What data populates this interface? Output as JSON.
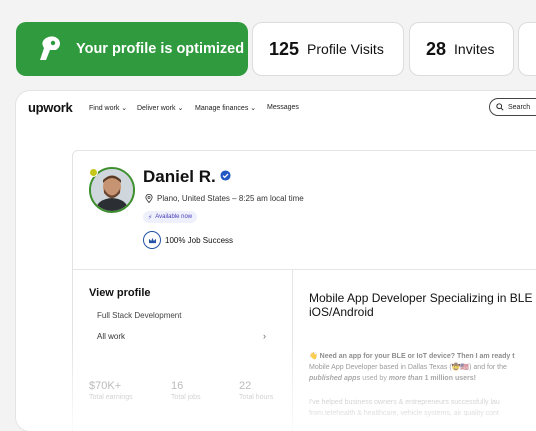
{
  "stats": {
    "optimized_text": "Your profile is optimized",
    "visits_count": "125",
    "visits_label": "Profile Visits",
    "invites_count": "28",
    "invites_label": "Invites",
    "accent_green": "#2f9a3e"
  },
  "nav": {
    "brand": "upwork",
    "items": [
      "Find work",
      "Deliver work",
      "Manage finances",
      "Messages"
    ],
    "search_placeholder": "Search"
  },
  "profile": {
    "name": "Daniel R.",
    "location": "Plano, United States – 8:25 am local time",
    "availability": "Available now",
    "job_success": "100% Job Success"
  },
  "sidebar": {
    "view_profile": "View profile",
    "specialty": "Full Stack Development",
    "all_work": "All work",
    "stats": [
      {
        "value": "$70K+",
        "label": "Total earnings"
      },
      {
        "value": "16",
        "label": "Total jobs"
      },
      {
        "value": "22",
        "label": "Total hours"
      }
    ]
  },
  "main": {
    "headline": "Mobile App Developer Specializing in BLE iOS/Android",
    "bio_line1": "Need an app for your BLE or IoT device? Then I am ready t",
    "bio_line2": "Mobile App Developer based in Dallas Texas",
    "bio_line2b": "and for the",
    "bio_line3a": "published apps",
    "bio_line3b": "used by",
    "bio_line3c": "more than",
    "bio_line3d": "1 million",
    "bio_line3e": "users!",
    "bio2_line1": "I've helped business owners & entrepreneurs successfully lau",
    "bio2_line2": "from telehealth & healthcare, vehicle systems, air quality cont"
  }
}
